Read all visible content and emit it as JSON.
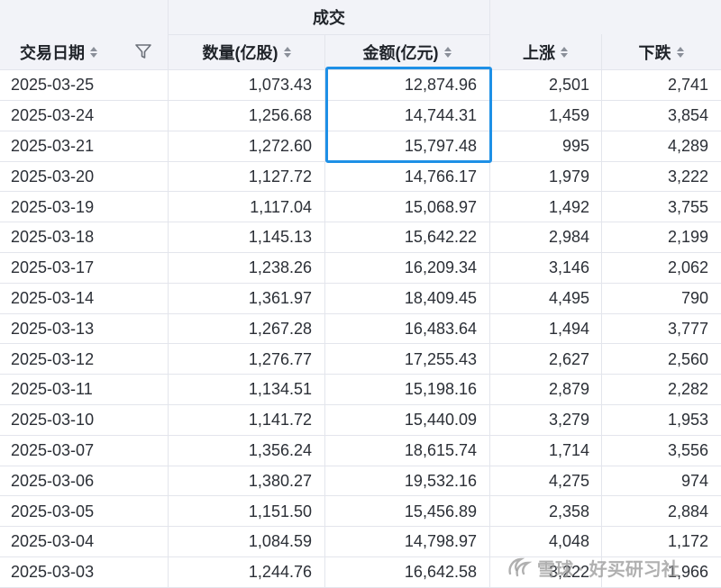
{
  "header": {
    "group_label": "成交",
    "columns": [
      "交易日期",
      "数量(亿股)",
      "金额(亿元)",
      "上涨",
      "下跌"
    ]
  },
  "rows": [
    {
      "date": "2025-03-25",
      "volume": "1,073.43",
      "amount": "12,874.96",
      "up": "2,501",
      "down": "2,741"
    },
    {
      "date": "2025-03-24",
      "volume": "1,256.68",
      "amount": "14,744.31",
      "up": "1,459",
      "down": "3,854"
    },
    {
      "date": "2025-03-21",
      "volume": "1,272.60",
      "amount": "15,797.48",
      "up": "995",
      "down": "4,289"
    },
    {
      "date": "2025-03-20",
      "volume": "1,127.72",
      "amount": "14,766.17",
      "up": "1,979",
      "down": "3,222"
    },
    {
      "date": "2025-03-19",
      "volume": "1,117.04",
      "amount": "15,068.97",
      "up": "1,492",
      "down": "3,755"
    },
    {
      "date": "2025-03-18",
      "volume": "1,145.13",
      "amount": "15,642.22",
      "up": "2,984",
      "down": "2,199"
    },
    {
      "date": "2025-03-17",
      "volume": "1,238.26",
      "amount": "16,209.34",
      "up": "3,146",
      "down": "2,062"
    },
    {
      "date": "2025-03-14",
      "volume": "1,361.97",
      "amount": "18,409.45",
      "up": "4,495",
      "down": "790"
    },
    {
      "date": "2025-03-13",
      "volume": "1,267.28",
      "amount": "16,483.64",
      "up": "1,494",
      "down": "3,777"
    },
    {
      "date": "2025-03-12",
      "volume": "1,276.77",
      "amount": "17,255.43",
      "up": "2,627",
      "down": "2,560"
    },
    {
      "date": "2025-03-11",
      "volume": "1,134.51",
      "amount": "15,198.16",
      "up": "2,879",
      "down": "2,282"
    },
    {
      "date": "2025-03-10",
      "volume": "1,141.72",
      "amount": "15,440.09",
      "up": "3,279",
      "down": "1,953"
    },
    {
      "date": "2025-03-07",
      "volume": "1,356.24",
      "amount": "18,615.74",
      "up": "1,714",
      "down": "3,556"
    },
    {
      "date": "2025-03-06",
      "volume": "1,380.27",
      "amount": "19,532.16",
      "up": "4,275",
      "down": "974"
    },
    {
      "date": "2025-03-05",
      "volume": "1,151.50",
      "amount": "15,456.89",
      "up": "2,358",
      "down": "2,884"
    },
    {
      "date": "2025-03-04",
      "volume": "1,084.59",
      "amount": "14,798.97",
      "up": "4,048",
      "down": "1,172"
    },
    {
      "date": "2025-03-03",
      "volume": "1,244.76",
      "amount": "16,642.58",
      "up": "3,222",
      "down": "1,966"
    }
  ],
  "highlight_color": "#1e90e6",
  "watermark": "雪球 · 好买研习社",
  "icons": {
    "sort": "sort-icon",
    "filter": "filter-icon"
  }
}
